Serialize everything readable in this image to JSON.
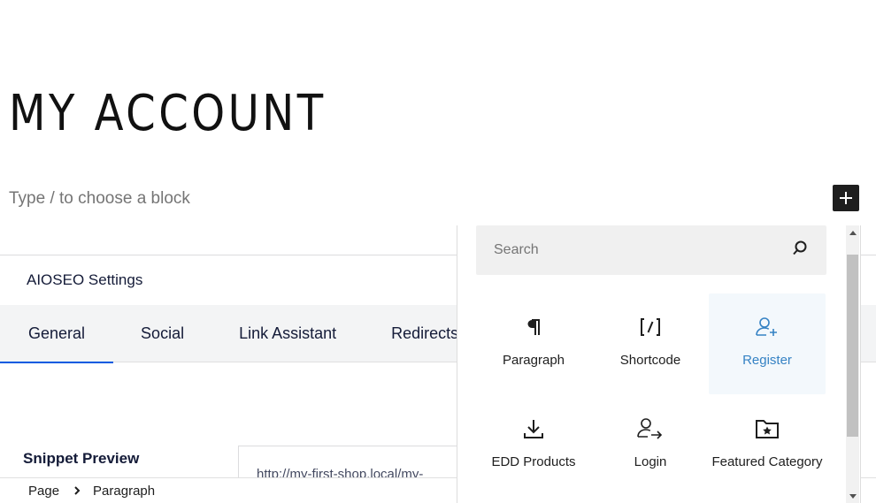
{
  "page": {
    "title": "MY ACCOUNT",
    "block_placeholder": "Type / to choose a block"
  },
  "aioseo": {
    "header": "AIOSEO Settings",
    "tabs": [
      {
        "label": "General",
        "active": true
      },
      {
        "label": "Social",
        "active": false
      },
      {
        "label": "Link Assistant",
        "active": false
      },
      {
        "label": "Redirects",
        "active": false
      }
    ],
    "snippet_label": "Snippet Preview",
    "snippet_url": "http://my-first-shop.local/my-"
  },
  "inserter": {
    "search_placeholder": "Search",
    "blocks": [
      {
        "label": "Paragraph",
        "icon": "paragraph-icon",
        "highlighted": false
      },
      {
        "label": "Shortcode",
        "icon": "shortcode-icon",
        "highlighted": false
      },
      {
        "label": "Register",
        "icon": "user-add-icon",
        "highlighted": true
      },
      {
        "label": "EDD Products",
        "icon": "download-icon",
        "highlighted": false
      },
      {
        "label": "Login",
        "icon": "user-login-icon",
        "highlighted": false
      },
      {
        "label": "Featured Category",
        "icon": "folder-star-icon",
        "highlighted": false
      }
    ]
  },
  "breadcrumb": {
    "items": [
      "Page",
      "Paragraph"
    ]
  },
  "colors": {
    "accent": "#3582c4",
    "tab_underline": "#005ae0",
    "toggle_bg": "#1e1e1e"
  }
}
